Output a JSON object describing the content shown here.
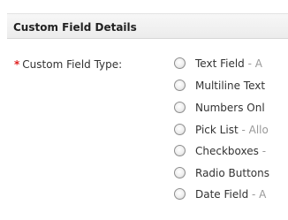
{
  "section": {
    "title": "Custom Field Details"
  },
  "field": {
    "required_marker": "*",
    "label": "Custom Field Type:"
  },
  "options": [
    {
      "label": "Text Field",
      "desc": " - A"
    },
    {
      "label": "Multiline Text",
      "desc": ""
    },
    {
      "label": "Numbers Onl",
      "desc": ""
    },
    {
      "label": "Pick List",
      "desc": " - Allo"
    },
    {
      "label": "Checkboxes",
      "desc": " -"
    },
    {
      "label": "Radio Buttons",
      "desc": ""
    },
    {
      "label": "Date Field",
      "desc": " - A"
    }
  ],
  "colors": {
    "required": "#e02020",
    "header_bg": "#f0f0f0"
  }
}
